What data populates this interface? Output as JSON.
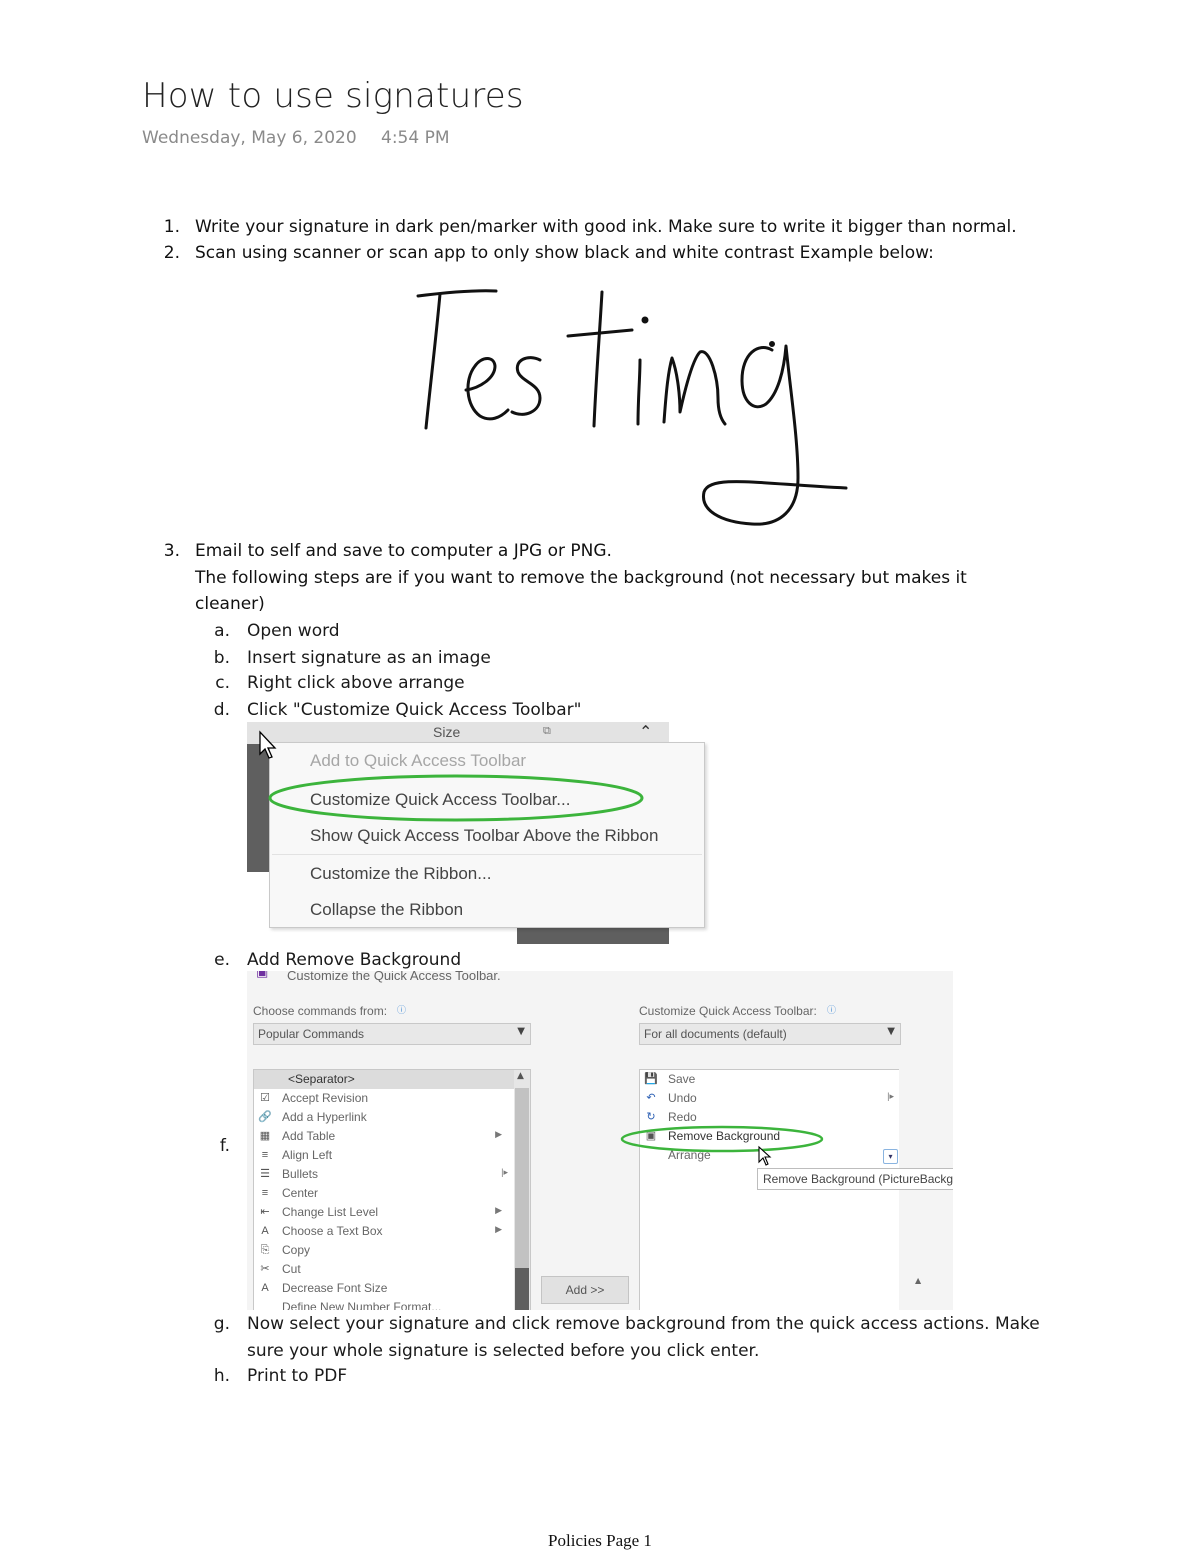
{
  "page": {
    "title": "How to use signatures",
    "date": "Wednesday, May 6, 2020",
    "time": "4:54 PM",
    "footer": "Policies Page 1"
  },
  "steps": [
    {
      "num": "1.",
      "text": "Write your signature in dark pen/marker with good ink. Make sure to write it bigger than normal."
    },
    {
      "num": "2.",
      "text": "Scan using scanner or scan app to only show black and white contrast Example below:"
    },
    {
      "num": "3.",
      "text": "Email to self and save to computer a JPG or PNG."
    }
  ],
  "step3_note": {
    "line1": "The following steps are if you want to remove the background (not necessary but makes it",
    "line2": "cleaner)"
  },
  "substeps": [
    {
      "letter": "a.",
      "text": "Open word"
    },
    {
      "letter": "b.",
      "text": "Insert signature as an image"
    },
    {
      "letter": "c.",
      "text": "Right click above arrange"
    },
    {
      "letter": "d.",
      "text": "Click \"Customize Quick Access Toolbar\""
    },
    {
      "letter": "e.",
      "text": "Add Remove Background"
    },
    {
      "letter": "f.",
      "text": ""
    },
    {
      "letter": "g.",
      "text": "Now select your signature and click remove background from the quick access actions. Make"
    },
    {
      "letter": "h.",
      "text": "Print to PDF"
    }
  ],
  "substep_g_line2": "sure your whole signature is selected before you click enter.",
  "signature_sample": "Testing",
  "context_menu": {
    "ribbon_label": "Size",
    "items": [
      "Add to Quick Access Toolbar",
      "Customize Quick Access Toolbar...",
      "Show Quick Access Toolbar Above the Ribbon",
      "Customize the Ribbon...",
      "Collapse the Ribbon"
    ],
    "highlight_color": "#3cb43c"
  },
  "options_dialog": {
    "header": "Customize the Quick Access Toolbar.",
    "choose_label": "Choose commands from:",
    "choose_value": "Popular Commands",
    "customize_label": "Customize Quick Access Toolbar:",
    "customize_value": "For all documents (default)",
    "commands": [
      {
        "icon": "",
        "label": "<Separator>"
      },
      {
        "icon": "☑",
        "label": "Accept Revision"
      },
      {
        "icon": "🔗",
        "label": "Add a Hyperlink"
      },
      {
        "icon": "▦",
        "label": "Add Table"
      },
      {
        "icon": "≡",
        "label": "Align Left"
      },
      {
        "icon": "☰",
        "label": "Bullets"
      },
      {
        "icon": "≡",
        "label": "Center"
      },
      {
        "icon": "⇤",
        "label": "Change List Level"
      },
      {
        "icon": "A",
        "label": "Choose a Text Box"
      },
      {
        "icon": "⎘",
        "label": "Copy"
      },
      {
        "icon": "✂",
        "label": "Cut"
      },
      {
        "icon": "A",
        "label": "Decrease Font Size"
      },
      {
        "icon": "",
        "label": "Define New Number Format..."
      }
    ],
    "toolbar_items": [
      {
        "icon": "💾",
        "label": "Save"
      },
      {
        "icon": "↶",
        "label": "Undo"
      },
      {
        "icon": "↻",
        "label": "Redo"
      },
      {
        "icon": "▣",
        "label": "Remove Background"
      },
      {
        "icon": "",
        "label": "Arrange"
      }
    ],
    "tooltip": "Remove Background (PictureBackg",
    "add_button": "Add >>"
  }
}
